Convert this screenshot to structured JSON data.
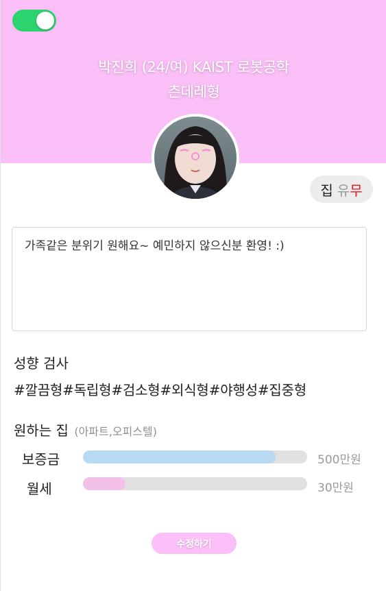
{
  "profile": {
    "title_line1": "박진희 (24/여) KAIST 로봇공학",
    "title_line2": "츤데레형",
    "toggle_on": true
  },
  "house_badge": {
    "house": "집",
    "yu": "유",
    "mu": "무"
  },
  "intro": {
    "text": "가족같은 분위기 원해요~ 예민하지 않으신분 환영! :)"
  },
  "personality": {
    "title": "성향 검사",
    "tags": "#깔끔형#독립형#검소형#외식형#야행성#집중형"
  },
  "desired_house": {
    "title": "원하는 집",
    "subtitle": "(아파트,오피스텔)",
    "deposit_label": "보증금",
    "deposit_value": "500만원",
    "deposit_level": 0.86,
    "rent_label": "월세",
    "rent_value": "30만원",
    "rent_level": 0.19
  },
  "actions": {
    "edit_label": "수정하기"
  },
  "colors": {
    "header": "#fbbff7",
    "toggle": "#2dd36f",
    "deposit_bar": "#b7d9f2",
    "rent_bar": "#f3c0e7",
    "mu_red": "#e8141c"
  }
}
